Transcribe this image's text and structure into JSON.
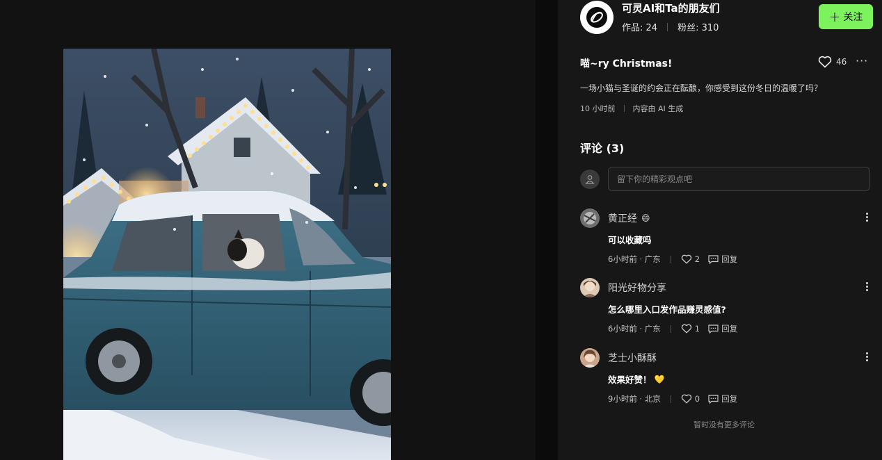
{
  "author": {
    "name": "可灵AI和Ta的朋友们",
    "works_label": "作品: 24",
    "fans_label": "粉丝: 310",
    "follow_label": "关注"
  },
  "work": {
    "title": "喵~ry Christmas!",
    "likes": "46",
    "description": "一场小猫与圣诞的约会正在酝酿，你感受到这份冬日的温暖了吗？",
    "time": "10 小时前",
    "ai_tag": "内容由 AI 生成"
  },
  "comments": {
    "header": "评论 (3)",
    "input_placeholder": "留下你的精彩观点吧",
    "items": [
      {
        "user": "黄正经",
        "emoji": "😄",
        "text": "可以收藏吗",
        "meta": "6小时前 · 广东",
        "likes": "2",
        "reply_label": "回复"
      },
      {
        "user": "阳光好物分享",
        "emoji": "",
        "text": "怎么哪里入口发作品赚灵感值?",
        "meta": "6小时前 · 广东",
        "likes": "1",
        "reply_label": "回复"
      },
      {
        "user": "芝士小酥酥",
        "emoji": "💛",
        "text": "效果好赞！",
        "meta": "9小时前 · 北京",
        "likes": "0",
        "reply_label": "回复"
      }
    ],
    "end_note": "暂时没有更多评论"
  },
  "colors": {
    "accent": "#7cf25c",
    "panel_bg": "#171717",
    "page_bg": "#0b0b0c"
  },
  "icons": [
    "kling-logo-icon",
    "plus-icon",
    "heart-icon",
    "more-horizontal-icon",
    "user-icon",
    "more-vertical-icon",
    "chat-bubble-icon"
  ]
}
